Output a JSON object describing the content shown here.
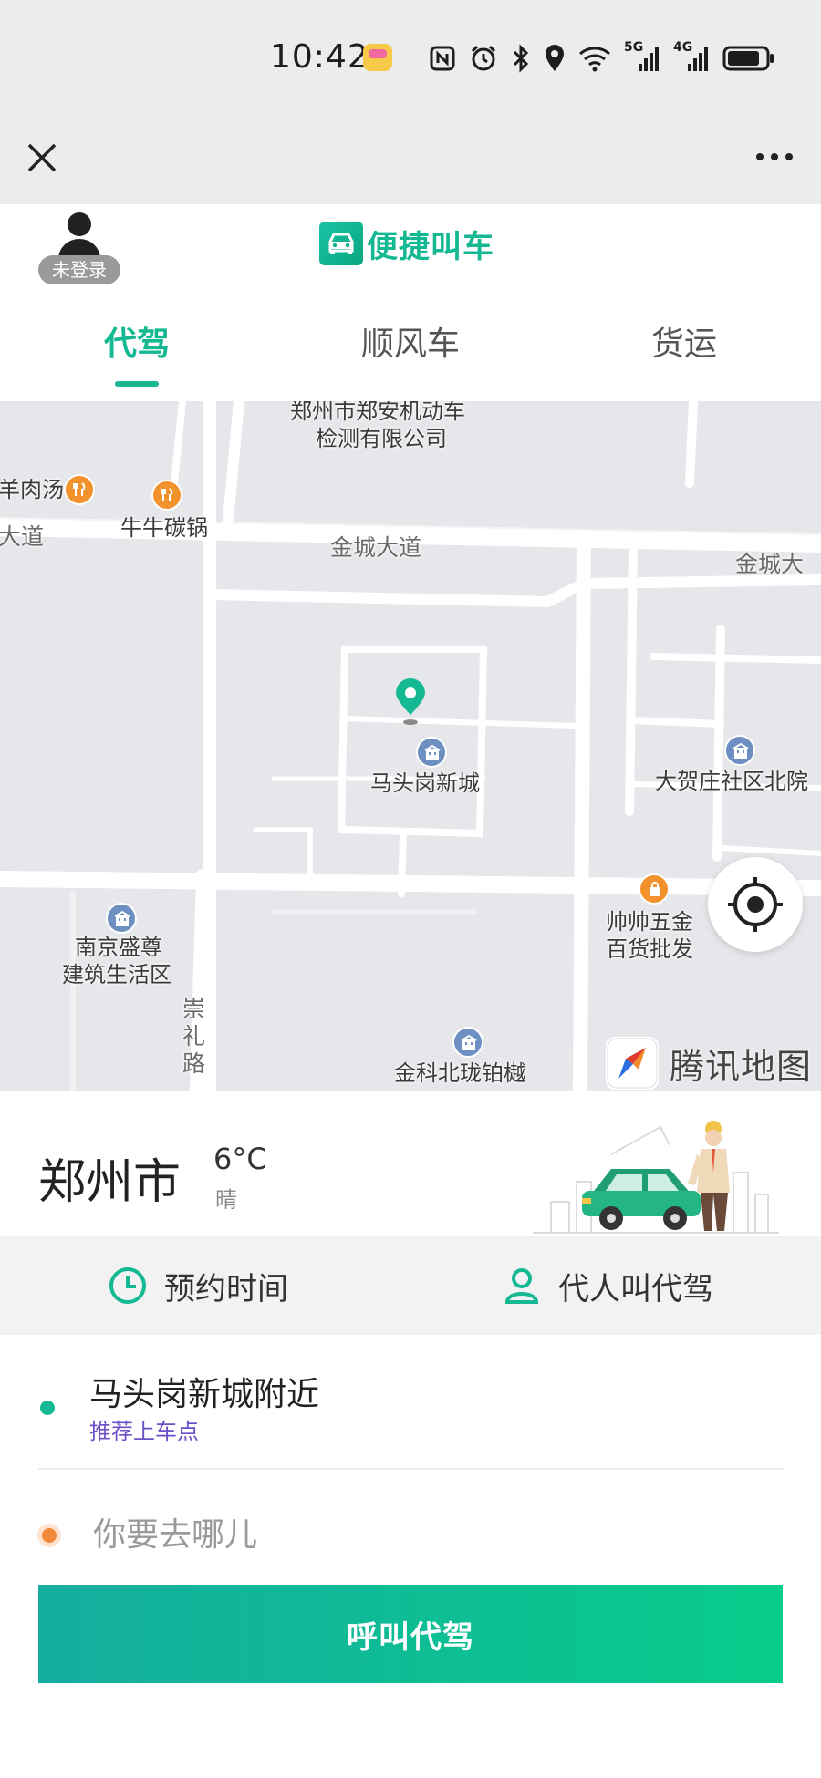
{
  "status_bar": {
    "time": "10:42",
    "network_5g": "5G",
    "network_4g": "4G",
    "icons": [
      "nfc-icon",
      "alarm-icon",
      "bluetooth-icon",
      "location-icon",
      "wifi-icon",
      "signal-5g-icon",
      "signal-4g-icon",
      "battery-icon"
    ]
  },
  "nav": {
    "close_icon": "close-icon",
    "more_icon": "more-icon"
  },
  "header": {
    "login_badge": "未登录",
    "brand_title": "便捷叫车",
    "brand_icon": "car-icon"
  },
  "tabs": [
    {
      "label": "代驾",
      "active": true
    },
    {
      "label": "顺风车",
      "active": false
    },
    {
      "label": "货运",
      "active": false
    }
  ],
  "map": {
    "labels": {
      "poi_top_line1": "郑州市郑安机动车",
      "poi_top_line2": "检测有限公司",
      "lamb_soup": "羊肉汤",
      "beef_pot": "牛牛碳锅",
      "avenue_left": "大道",
      "jincheng_road": "金城大道",
      "jincheng_road_right": "金城大",
      "matougang": "马头岗新城",
      "dahezhuang": "大贺庄社区北院",
      "nanjing_line1": "南京盛尊",
      "nanjing_line2": "建筑生活区",
      "shuaishuai_line1": "帅帅五金",
      "shuaishuai_line2": "百货批发",
      "chongli_road": "崇礼路",
      "jinke": "金科北珑铂樾"
    },
    "provider": "腾讯地图",
    "colors": {
      "road": "#ffffff",
      "land": "#e6e7ea",
      "pin": "#14b892"
    }
  },
  "weather": {
    "city": "郑州市",
    "temperature": "6°C",
    "condition": "晴"
  },
  "options": {
    "schedule": "预约时间",
    "on_behalf": "代人叫代驾"
  },
  "trip": {
    "pickup": "马头岗新城附近",
    "pickup_hint": "推荐上车点",
    "destination_placeholder": "你要去哪儿",
    "call_button": "呼叫代驾"
  },
  "theme": {
    "accent": "#14b892",
    "hint_purple": "#6b4fc7",
    "destination_dot": "#f08a3a"
  }
}
